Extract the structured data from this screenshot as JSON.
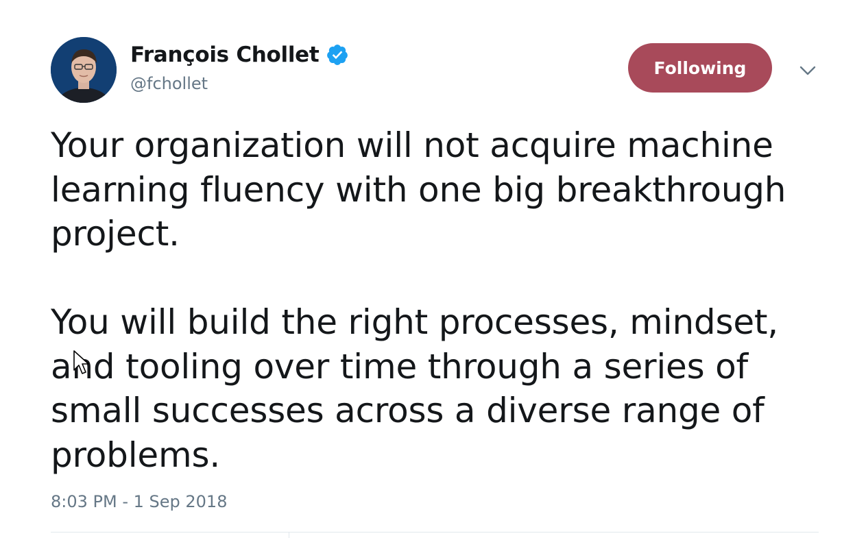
{
  "author": {
    "display_name": "François Chollet",
    "handle": "@fchollet",
    "verified": true
  },
  "follow_button": {
    "label": "Following",
    "color": "#a84a5a"
  },
  "menu": {
    "icon": "chevron-down-icon"
  },
  "tweet": {
    "paragraphs": [
      "Your organization will not acquire machine learning fluency with one big breakthrough project.",
      "You will build the right processes, mindset, and tooling over time through a series of small successes across a diverse range of problems."
    ],
    "timestamp": "8:03 PM - 1 Sep 2018"
  },
  "colors": {
    "verified_badge": "#1da1f2",
    "secondary_text": "#657786",
    "primary_text": "#14171a"
  }
}
